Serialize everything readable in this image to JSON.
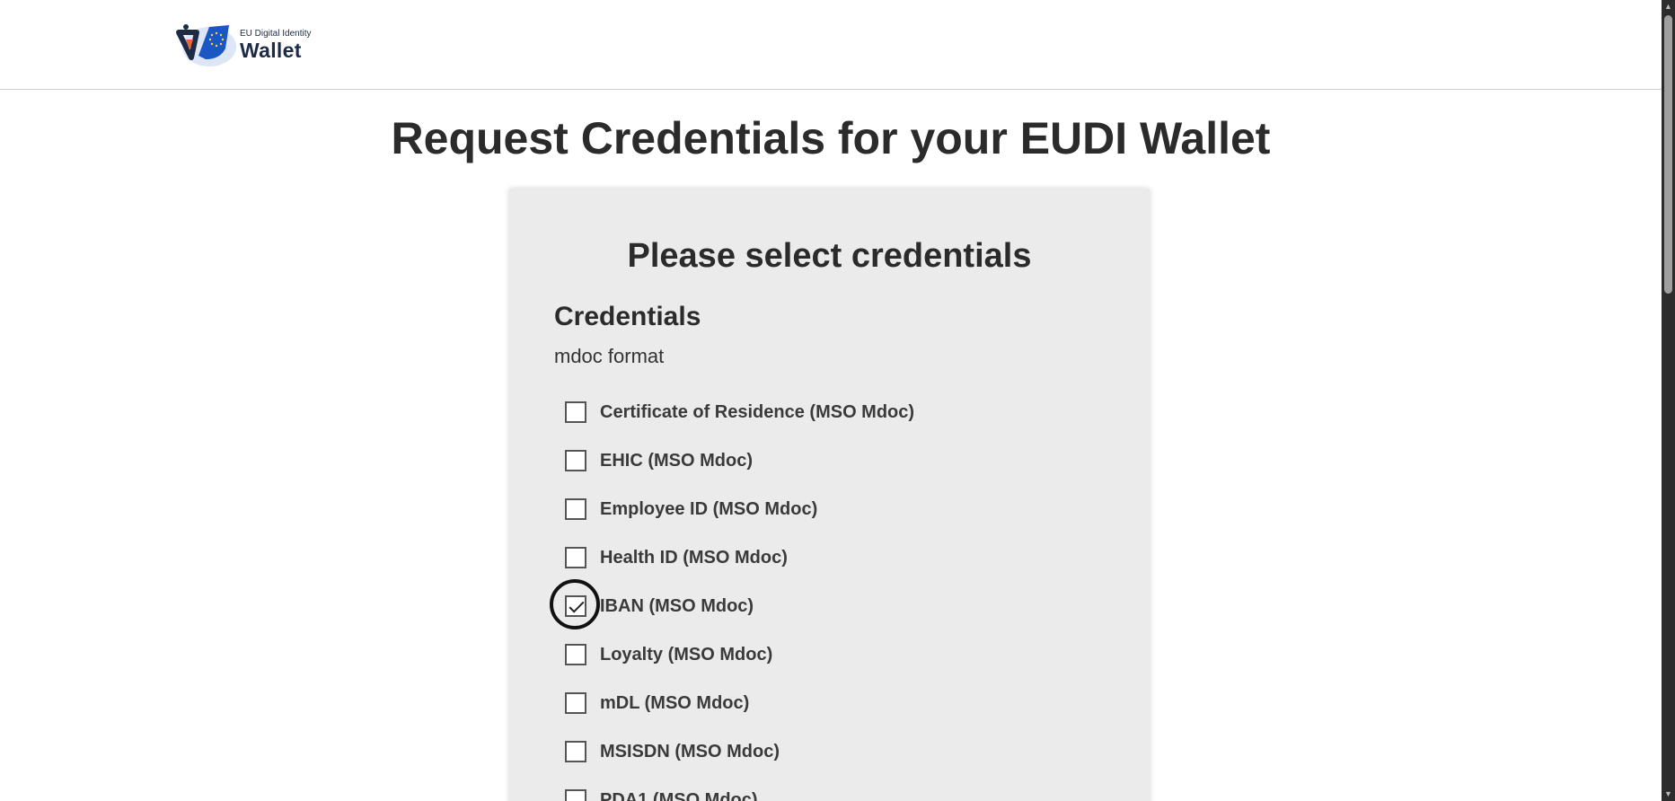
{
  "header": {
    "logo_small": "EU Digital Identity",
    "logo_big": "Wallet"
  },
  "page": {
    "title": "Request Credentials for your EUDI Wallet"
  },
  "card": {
    "title": "Please select credentials",
    "section_title": "Credentials",
    "format_label": "mdoc format",
    "items": [
      {
        "label": "Certificate of Residence (MSO Mdoc)",
        "checked": false
      },
      {
        "label": "EHIC (MSO Mdoc)",
        "checked": false
      },
      {
        "label": "Employee ID (MSO Mdoc)",
        "checked": false
      },
      {
        "label": "Health ID (MSO Mdoc)",
        "checked": false
      },
      {
        "label": "IBAN (MSO Mdoc)",
        "checked": true
      },
      {
        "label": "Loyalty (MSO Mdoc)",
        "checked": false
      },
      {
        "label": "mDL (MSO Mdoc)",
        "checked": false
      },
      {
        "label": "MSISDN (MSO Mdoc)",
        "checked": false
      },
      {
        "label": "PDA1 (MSO Mdoc)",
        "checked": false
      }
    ]
  },
  "colors": {
    "card_background": "#ebebeb",
    "title_text": "#2b2b2b",
    "logo_navy": "#1d2b47",
    "logo_blue": "#1a56c4",
    "logo_orange": "#e8663a"
  }
}
